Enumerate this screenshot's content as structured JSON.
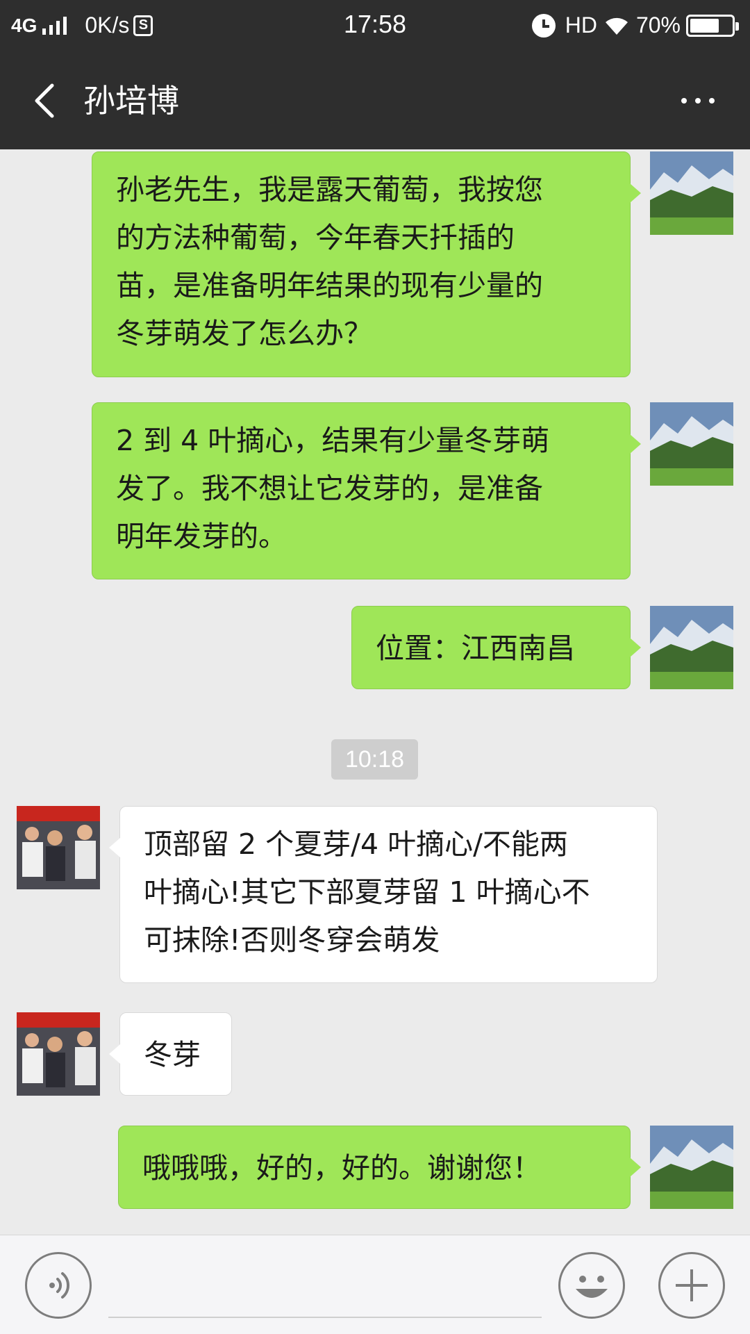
{
  "status_bar": {
    "network": "4G",
    "speed": "0K/s",
    "s_icon": "S",
    "time": "17:58",
    "hd": "HD",
    "battery": "70%",
    "battery_level": 0.7
  },
  "header": {
    "title": "孙培博",
    "back_icon": "chevron-left-icon",
    "more_icon": "more-dots-icon"
  },
  "messages": [
    {
      "side": "right",
      "lines": [
        "孙老先生，我是露天葡萄，我按您",
        "的方法种葡萄，今年春天扦插的",
        "苗，是准备明年结果的现有少量的",
        "冬芽萌发了怎么办？"
      ]
    },
    {
      "side": "right",
      "lines": [
        "2 到 4 叶摘心，结果有少量冬芽萌",
        "发了。我不想让它发芽的，是准备",
        "明年发芽的。"
      ]
    },
    {
      "side": "right",
      "lines": [
        "位置：江西南昌"
      ]
    },
    {
      "side": "left",
      "lines": [
        "顶部留 2 个夏芽/4 叶摘心/不能两",
        "叶摘心!其它下部夏芽留 1 叶摘心不",
        "可抹除!否则冬穿会萌发"
      ]
    },
    {
      "side": "left",
      "lines": [
        "冬芽"
      ]
    },
    {
      "side": "right",
      "lines": [
        "哦哦哦，好的，好的。谢谢您！"
      ]
    }
  ],
  "timestamp": "10:18",
  "input_bar": {
    "voice_icon": "voice-icon",
    "emoji_icon": "emoji-icon",
    "plus_icon": "plus-icon"
  },
  "colors": {
    "bar_bg": "#2e2e2e",
    "chat_bg": "#ebebeb",
    "green_bubble": "#9fe658",
    "white_bubble": "#ffffff"
  }
}
